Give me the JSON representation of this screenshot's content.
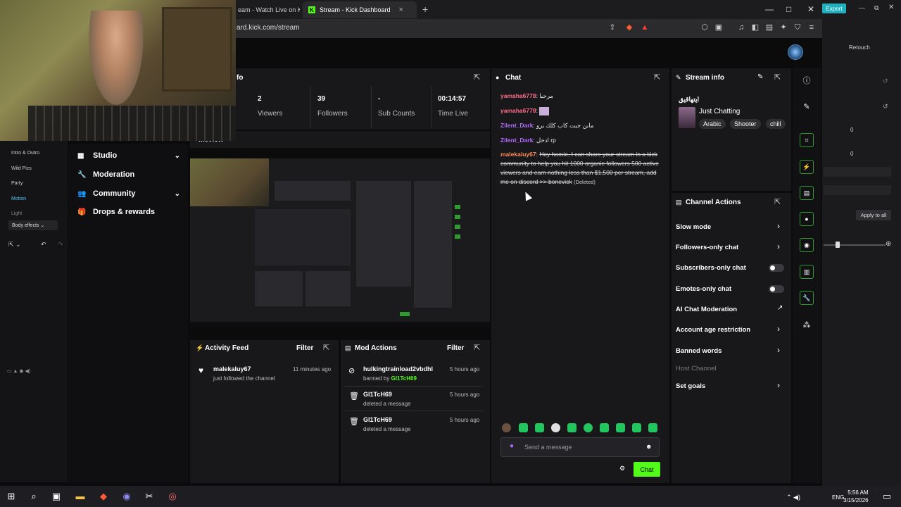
{
  "browser": {
    "tabs": [
      {
        "title": "eam - Watch Live on Kic"
      },
      {
        "title": "Stream - Kick Dashboard",
        "close": "×"
      }
    ],
    "new_tab": "+",
    "url": "ard.kick.com/stream",
    "window_controls": {
      "minimize": "—",
      "maximize": "□",
      "close": "✕"
    }
  },
  "stats": {
    "section_title": "fo",
    "items": [
      {
        "value": "2",
        "label": "Viewers"
      },
      {
        "value": "39",
        "label": "Followers"
      },
      {
        "value": "-",
        "label": "Sub Counts"
      },
      {
        "value": "00:14:57",
        "label": "Time Live"
      }
    ]
  },
  "preview": {
    "title": "...eview"
  },
  "sidebar": {
    "items": [
      {
        "label": "Studio",
        "icon": "studio-icon",
        "chevron": "⌄"
      },
      {
        "label": "Moderation",
        "icon": "wrench-icon"
      },
      {
        "label": "Community",
        "icon": "community-icon",
        "chevron": "⌄"
      },
      {
        "label": "Drops & rewards",
        "icon": "gift-icon"
      }
    ]
  },
  "capcut_left": {
    "items": [
      "Intro & Outro",
      "Wild Pics",
      "Party",
      "Motion",
      "Light"
    ],
    "dropdown": "Body effects"
  },
  "activity_feed": {
    "title": "Activity Feed",
    "filter": "Filter",
    "entries": [
      {
        "name": "malekaluy67",
        "sub": "just followed the channel",
        "time": "11 minutes ago"
      }
    ]
  },
  "mod_actions": {
    "title": "Mod Actions",
    "filter": "Filter",
    "entries": [
      {
        "name": "hulkingtrainload2vbdhl",
        "sub_prefix": "banned by ",
        "sub_user": "Gl1TcH69",
        "time": "5 hours ago"
      },
      {
        "name": "Gl1TcH69",
        "sub": "deleted a message",
        "time": "5 hours ago"
      },
      {
        "name": "Gl1TcH69",
        "sub": "deleted a message",
        "time": "5 hours ago"
      }
    ]
  },
  "chat": {
    "title": "Chat",
    "messages": [
      {
        "user": "yamaha6778",
        "text": "مرحبا"
      },
      {
        "user": "yamaha6778",
        "text": ""
      },
      {
        "user": "Zilent_Dark",
        "text": "مابن جبت كاب كلك برو"
      },
      {
        "user": "Zilent_Dark",
        "text": "ادخل rp"
      },
      {
        "user": "malekaiuy67",
        "text": "Hey homie, I can share your stream in a kick community to help you hit 1000 organic followers 500 active viewers and earn nothing less than $1,500 per stream, add me on discord >> bonevick",
        "deleted_tag": "(Deleted)"
      }
    ],
    "input_placeholder": "Send a message",
    "send_label": "Chat"
  },
  "stream_info": {
    "title": "Stream info",
    "stream_title": "ايتهاقيق",
    "category": "Just Chatting",
    "tags": [
      "Arabic",
      "Shooter",
      "chill"
    ]
  },
  "channel_actions": {
    "title": "Channel Actions",
    "rows": [
      {
        "label": "Slow mode",
        "control": "arrow"
      },
      {
        "label": "Followers-only chat",
        "control": "arrow"
      },
      {
        "label": "Subscribers-only chat",
        "control": "toggle"
      },
      {
        "label": "Emotes-only chat",
        "control": "toggle"
      },
      {
        "label": "AI Chat Moderation",
        "control": "external"
      },
      {
        "label": "Account age restriction",
        "control": "arrow"
      },
      {
        "label": "Banned words",
        "control": "arrow"
      },
      {
        "label": "Host Channel",
        "control": "none"
      },
      {
        "label": "Set goals",
        "control": "arrow"
      }
    ]
  },
  "capcut_right": {
    "export": "Export",
    "retouch": "Retouch",
    "values": [
      "0",
      "0"
    ],
    "apply_all": "Apply to all"
  },
  "taskbar": {
    "time": "5:56 AM",
    "date": "3/15/2026",
    "lang": "ENG"
  },
  "colors": {
    "kick_green": "#53fc18",
    "panel_bg": "#18181b",
    "page_bg": "#0b0b0c",
    "username_red": "#ff6b8a",
    "username_purple": "#b06bff"
  }
}
